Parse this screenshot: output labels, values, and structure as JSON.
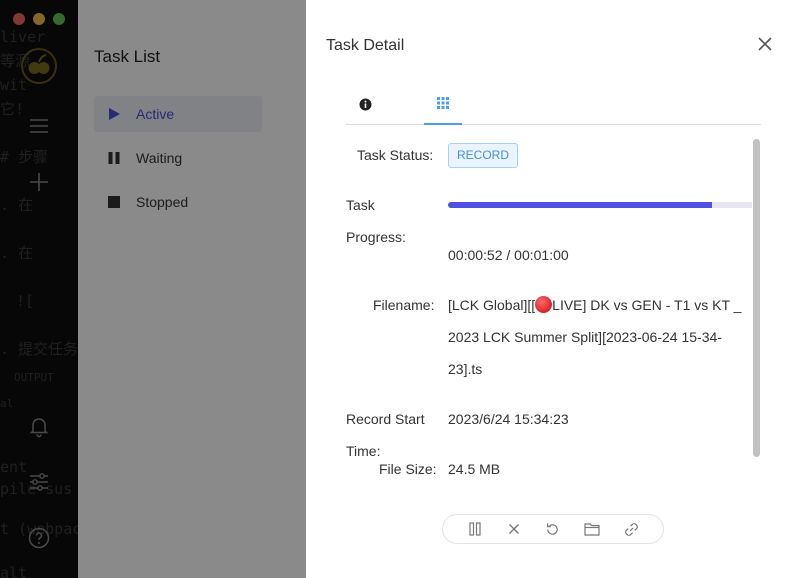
{
  "app": {
    "window_controls": [
      "close",
      "minimize",
      "zoom"
    ]
  },
  "background_code": [
    {
      "text": "liver"
    },
    {
      "text": "等源"
    },
    {
      "text": "wit"
    },
    {
      "text": "它!"
    },
    {
      "text": "# 步骤"
    },
    {
      "text": ". 在"
    },
    {
      "text": ". 在"
    },
    {
      "text": "!["
    },
    {
      "text": ". 提交任务"
    },
    {
      "text": "OUTPUT"
    },
    {
      "text": "al"
    },
    {
      "text": "ent"
    },
    {
      "text": "pile sus"
    },
    {
      "text": "t (webpac"
    },
    {
      "text": "alt"
    }
  ],
  "sidebar": {
    "icons": [
      "menu-icon",
      "add-icon",
      "bell-icon",
      "settings-sliders-icon",
      "help-icon"
    ]
  },
  "task_list": {
    "title": "Task List",
    "items": [
      {
        "label": "Active",
        "icon": "play-icon",
        "active": true
      },
      {
        "label": "Waiting",
        "icon": "pause-icon",
        "active": false
      },
      {
        "label": "Stopped",
        "icon": "stop-icon",
        "active": false
      }
    ]
  },
  "detail": {
    "title": "Task Detail",
    "tabs": [
      {
        "icon": "info-icon",
        "selected": false
      },
      {
        "icon": "grid-icon",
        "selected": true
      }
    ],
    "status_label": "Task Status:",
    "status_value": "RECORD",
    "progress_label_line1": "Task",
    "progress_label_line2": "Progress:",
    "progress_fraction": 0.867,
    "progress_text": "00:00:52 / 00:01:00",
    "filename_label": "Filename:",
    "filename_before_icon": "[LCK Global][[",
    "filename_after_icon": "LIVE] DK vs GEN - T1 vs KT _ 2023 LCK Summer Split][2023-06-24 15-34-23].ts",
    "record_start_label_line1": "Record Start",
    "record_start_label_line2": "Time:",
    "record_start_value": "2023/6/24 15:34:23",
    "file_size_label": "File Size:",
    "file_size_value": "24.5 MB",
    "actions": [
      "pause-icon",
      "cancel-icon",
      "retry-icon",
      "folder-icon",
      "link-icon"
    ]
  },
  "colors": {
    "accent": "#4f52e0",
    "badge_border": "#a9cff6",
    "badge_bg": "#eaf4fe",
    "badge_text": "#4a8fd8",
    "tab_underline": "#4b9ff0"
  }
}
